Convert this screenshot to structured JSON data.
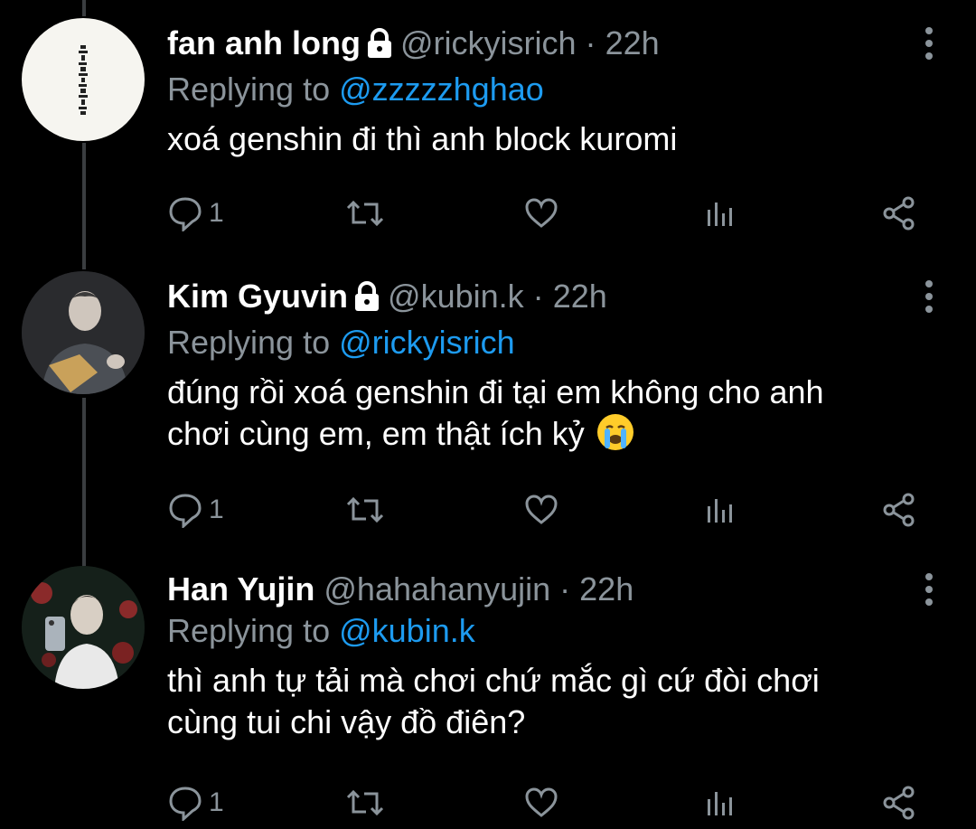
{
  "tweets": [
    {
      "name": "fan anh long",
      "handle": "@rickyisrich",
      "dot": "·",
      "time": "22h",
      "replying_prefix": "Replying to ",
      "replying_to": "@zzzzzhghao",
      "text": "xoá genshin đi thì anh block kuromi",
      "reply_count": "1",
      "avatar_text": "ROLE MODEL",
      "locked": true
    },
    {
      "name": "Kim Gyuvin",
      "handle": "@kubin.k",
      "dot": "·",
      "time": "22h",
      "replying_prefix": "Replying to ",
      "replying_to": "@rickyisrich",
      "text_line1": "đúng rồi xoá genshin đi tại em không cho anh",
      "text_line2": "chơi cùng em, em thật ích kỷ",
      "reply_count": "1",
      "locked": true
    },
    {
      "name": "Han Yujin",
      "handle": "@hahahanyujin",
      "dot": "·",
      "time": "22h",
      "replying_prefix": "Replying to ",
      "replying_to": "@kubin.k",
      "text_line1": "thì anh tự tải mà chơi chứ mắc gì cứ đòi chơi",
      "text_line2": "cùng tui chi vậy đồ điên?",
      "reply_count": "1",
      "locked": false
    }
  ],
  "icons": {
    "reply": "reply-icon",
    "retweet": "retweet-icon",
    "like": "heart-icon",
    "analytics": "analytics-icon",
    "share": "share-icon",
    "more": "more-vertical-icon",
    "lock": "lock-icon"
  },
  "colors": {
    "background": "#000000",
    "text": "#ffffff",
    "muted": "#8b949b",
    "link": "#1d9bf0",
    "thread_line": "#3a3d40"
  }
}
